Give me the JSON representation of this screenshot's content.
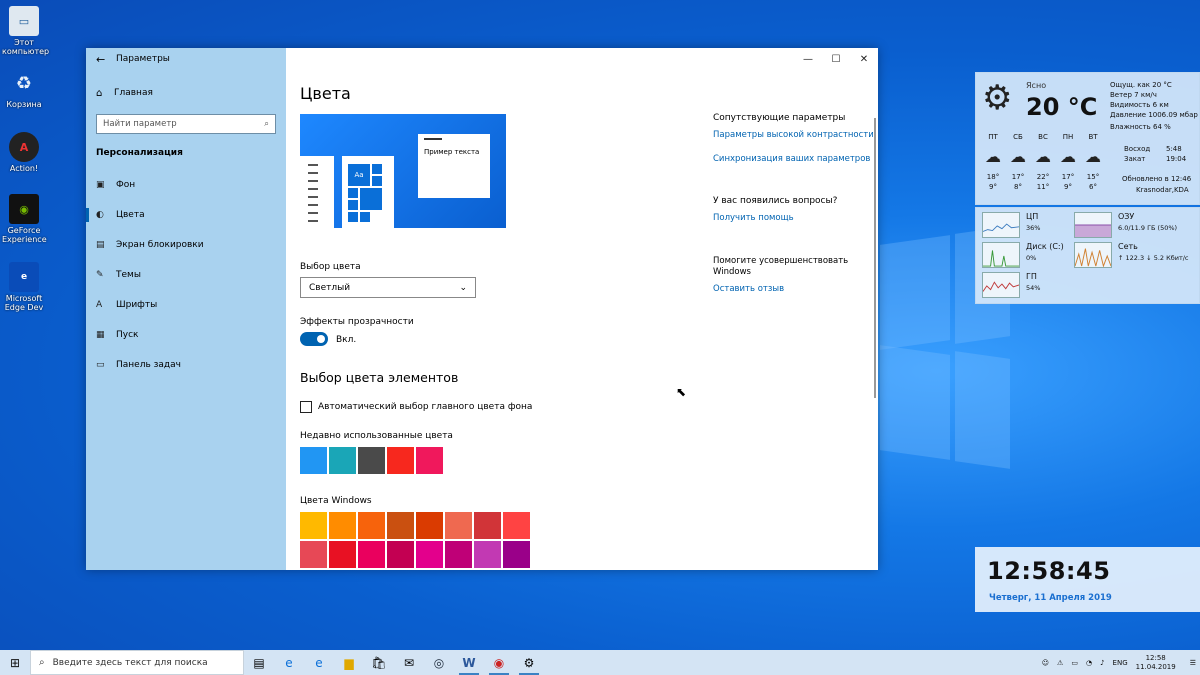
{
  "desktop_icons": [
    {
      "label": "Этот компьютер",
      "icon": "computer-icon"
    },
    {
      "label": "Корзина",
      "icon": "recycle-bin-icon"
    },
    {
      "label": "Action!",
      "icon": "action-app-icon"
    },
    {
      "label": "GeForce Experience",
      "icon": "geforce-icon"
    },
    {
      "label": "Microsoft Edge Dev",
      "icon": "edge-dev-icon"
    }
  ],
  "settings": {
    "window_title": "Параметры",
    "home_label": "Главная",
    "search_placeholder": "Найти параметр",
    "section_title": "Персонализация",
    "nav": [
      {
        "label": "Фон",
        "icon": "picture-icon"
      },
      {
        "label": "Цвета",
        "icon": "palette-icon",
        "active": true
      },
      {
        "label": "Экран блокировки",
        "icon": "lock-screen-icon"
      },
      {
        "label": "Темы",
        "icon": "themes-icon"
      },
      {
        "label": "Шрифты",
        "icon": "fonts-icon"
      },
      {
        "label": "Пуск",
        "icon": "start-icon"
      },
      {
        "label": "Панель задач",
        "icon": "taskbar-icon"
      }
    ],
    "page_title": "Цвета",
    "preview_sample_text": "Пример текста",
    "preview_tile_text": "Aa",
    "color_choice_label": "Выбор цвета",
    "color_choice_value": "Светлый",
    "transparency_label": "Эффекты прозрачности",
    "transparency_state": "Вкл.",
    "accent_heading": "Выбор цвета элементов",
    "auto_accent_label": "Автоматический выбор главного цвета фона",
    "recent_colors_label": "Недавно использованные цвета",
    "recent_colors": [
      "#2196f3",
      "#1aa6b7",
      "#4a4a4a",
      "#f7281e",
      "#f0185c"
    ],
    "windows_colors_label": "Цвета Windows",
    "windows_colors": [
      "#ffb900",
      "#ff8c00",
      "#f7630c",
      "#ca5010",
      "#da3b01",
      "#ef6950",
      "#d13438",
      "#ff4343",
      "#e74856",
      "#e81123",
      "#ea005e",
      "#c30052",
      "#e3008c",
      "#bf0077",
      "#c239b3",
      "#9a0089"
    ],
    "related_title": "Сопутствующие параметры",
    "related_links": [
      "Параметры высокой контрастности",
      "Синхронизация ваших параметров"
    ],
    "questions_title": "У вас появились вопросы?",
    "questions_link": "Получить помощь",
    "improve_title": "Помогите усовершенствовать Windows",
    "improve_link": "Оставить отзыв"
  },
  "weather": {
    "condition": "Ясно",
    "temperature": "20 °C",
    "details": [
      "Ощущ. как 20 °C",
      "Ветер      7 км/ч",
      "Видимость 6 км",
      "Давление  1006.09 мбар",
      "Влажность 64 %"
    ],
    "days": [
      {
        "name": "ПТ",
        "high": "18°",
        "low": "9°"
      },
      {
        "name": "СБ",
        "high": "17°",
        "low": "8°"
      },
      {
        "name": "ВС",
        "high": "22°",
        "low": "11°"
      },
      {
        "name": "ПН",
        "high": "17°",
        "low": "9°"
      },
      {
        "name": "ВТ",
        "high": "15°",
        "low": "6°"
      }
    ],
    "sunrise_label": "Восход",
    "sunrise": "5:48",
    "sunset_label": "Закат",
    "sunset": "19:04",
    "updated": "Обновлено в 12:46",
    "location": "Krasnodar,KDA"
  },
  "sysmon": {
    "cpu": {
      "title": "ЦП",
      "value": "36%"
    },
    "ram": {
      "title": "ОЗУ",
      "value": "6.0/11.9 ГБ (50%)"
    },
    "disk": {
      "title": "Диск (C:)",
      "value": "0%"
    },
    "net": {
      "title": "Сеть",
      "value": "↑ 122.3 ↓ 5.2 Кбит/с"
    },
    "gpu": {
      "title": "ГП",
      "value": "54%"
    }
  },
  "clock": {
    "time": "12:58:45",
    "date": "Четверг, 11 Апреля 2019"
  },
  "taskbar": {
    "search_placeholder": "Введите здесь текст для поиска",
    "lang": "ENG",
    "time": "12:58",
    "date": "11.04.2019"
  }
}
